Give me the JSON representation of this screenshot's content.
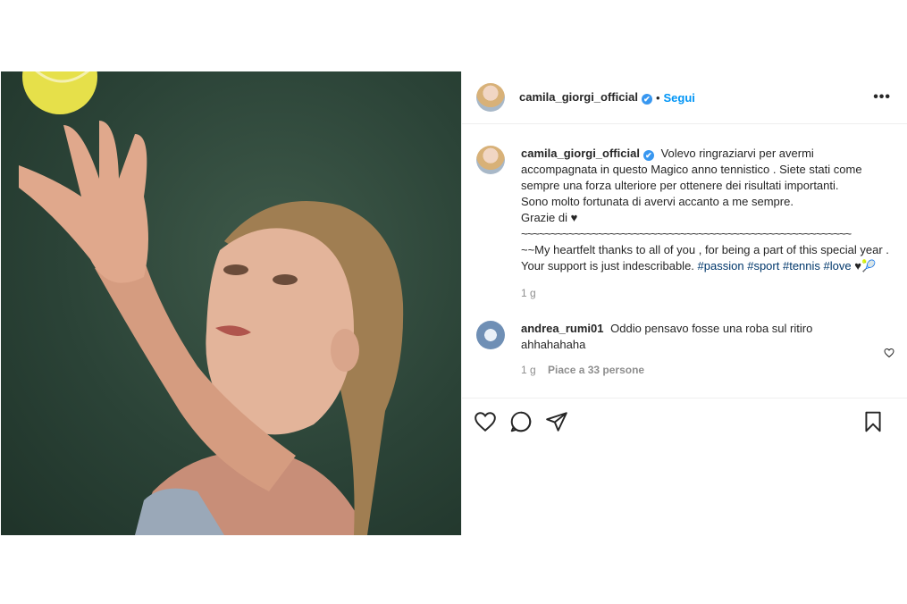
{
  "header": {
    "username": "camila_giorgi_official",
    "verified_glyph": "✔",
    "separator": "•",
    "follow_label": "Segui",
    "more_label": "•••"
  },
  "caption": {
    "username": "camila_giorgi_official",
    "verified_glyph": "✔",
    "line1": "Volevo ringraziarvi per avermi accompagnata in questo Magico anno tennistico . Siete stati come sempre una forza ulteriore per ottenere dei risultati importanti.",
    "line2": "Sono molto fortunata di avervi accanto a me sempre.",
    "line3": "Grazie di ♥",
    "line4": "~~~~~~~~~~~~~~~~~~~~~~~~~~~~~~~~~~~~~~~~~~~~~~~~~~~~~~~~",
    "line5": "~~My heartfelt thanks to all of you , for being a part of this special year . Your support is just indescribable.",
    "tags": [
      "#passion",
      "#sport",
      "#tennis",
      "#love"
    ],
    "tail": "♥🎾",
    "time": "1 g"
  },
  "comment": {
    "username": "andrea_rumi01",
    "text": "Oddio pensavo fosse una roba sul ritiro ahhahahaha",
    "time": "1 g",
    "likes": "Piace a 33 persone"
  },
  "icons": {
    "like": "heart-icon",
    "comment": "comment-icon",
    "share": "share-icon",
    "save": "bookmark-icon",
    "comment_like": "heart-icon"
  },
  "colors": {
    "link": "#0095f6",
    "hashtag": "#00376b",
    "verified": "#3897f0",
    "muted": "#8e8e8e"
  }
}
